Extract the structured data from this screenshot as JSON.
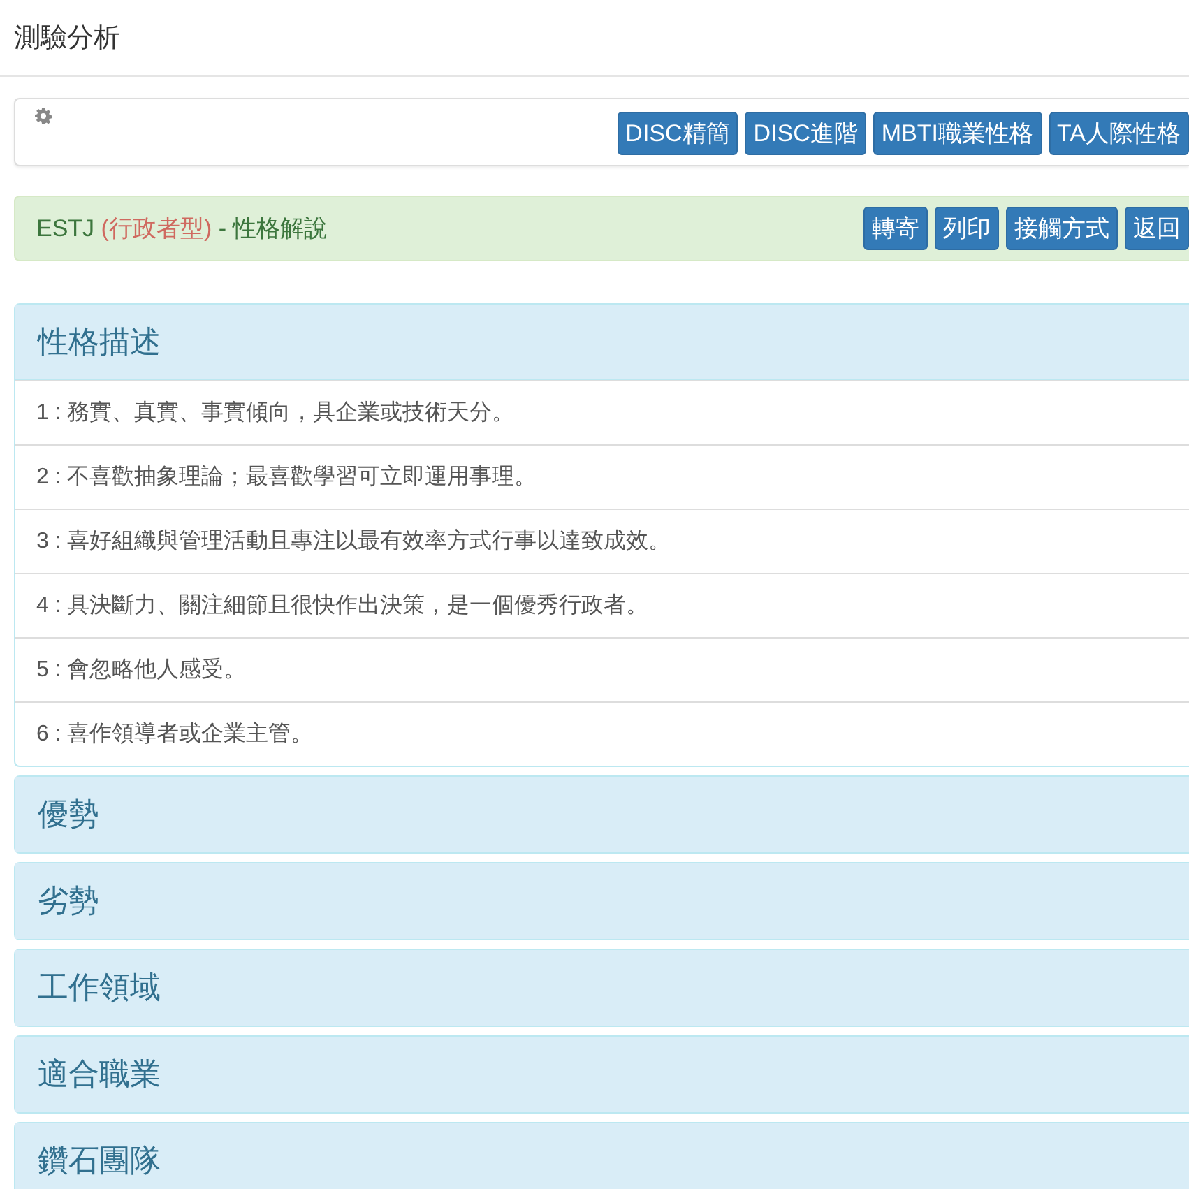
{
  "page_title": "測驗分析",
  "test_buttons": [
    "DISC精簡",
    "DISC進階",
    "MBTI職業性格",
    "TA人際性格"
  ],
  "result": {
    "code": "ESTJ",
    "type_name": "(行政者型)",
    "suffix": "- 性格解說",
    "actions": [
      "轉寄",
      "列印",
      "接觸方式",
      "返回"
    ]
  },
  "sections": [
    {
      "title": "性格描述",
      "expanded": true,
      "items": [
        "1 : 務實、真實、事實傾向，具企業或技術天分。",
        "2 : 不喜歡抽象理論；最喜歡學習可立即運用事理。",
        "3 : 喜好組織與管理活動且專注以最有效率方式行事以達致成效。",
        "4 : 具決斷力、關注細節且很快作出決策，是一個優秀行政者。",
        "5 : 會忽略他人感受。",
        "6 : 喜作領導者或企業主管。"
      ]
    },
    {
      "title": "優勢",
      "expanded": false
    },
    {
      "title": "劣勢",
      "expanded": false
    },
    {
      "title": "工作領域",
      "expanded": false
    },
    {
      "title": "適合職業",
      "expanded": false
    },
    {
      "title": "鑽石團隊",
      "expanded": false
    }
  ]
}
